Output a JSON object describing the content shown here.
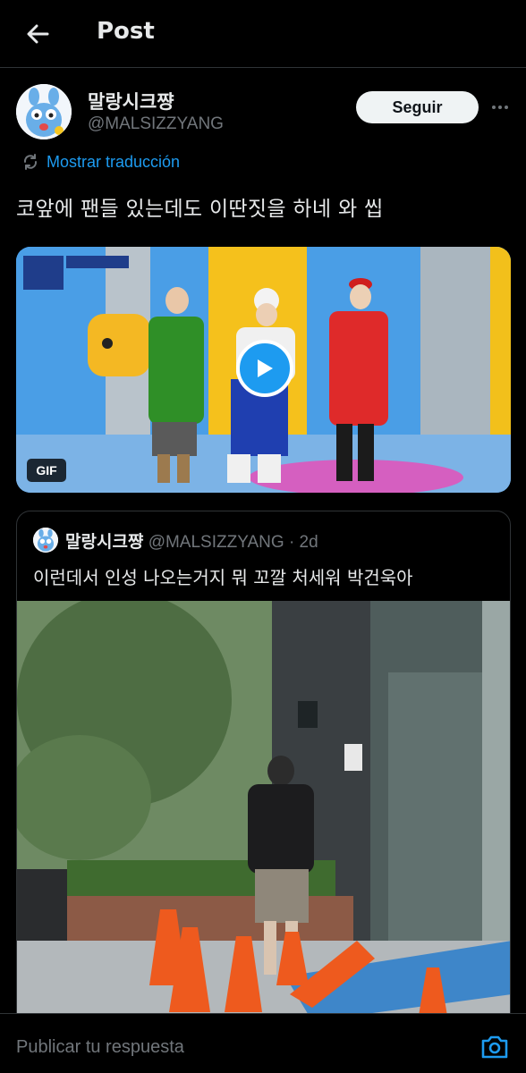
{
  "header": {
    "title": "Post",
    "back_icon": "arrow-left-icon"
  },
  "author": {
    "name": "말랑시크쨩",
    "handle": "@MALSIZZYANG",
    "follow_label": "Seguir",
    "more_icon": "more-dots-icon"
  },
  "translate": {
    "label": "Mostrar traducción",
    "icon": "translate-icon"
  },
  "post": {
    "text": "코앞에 팬들 있는데도 이딴짓을 하네 와 씹",
    "media": {
      "type": "gif",
      "badge": "GIF",
      "play_icon": "play-icon"
    }
  },
  "quote": {
    "name": "말랑시크쨩",
    "handle": "@MALSIZZYANG",
    "separator": "·",
    "time": "2d",
    "text": "이런데서 인성 나오는거지 뭐 꼬깔 처세워 박건욱아"
  },
  "reply": {
    "placeholder": "Publicar tu respuesta",
    "camera_icon": "camera-icon"
  },
  "colors": {
    "accent": "#1d9bf0",
    "background": "#000000",
    "text": "#e7e9ea",
    "muted": "#71767b",
    "border": "#2f3336"
  }
}
